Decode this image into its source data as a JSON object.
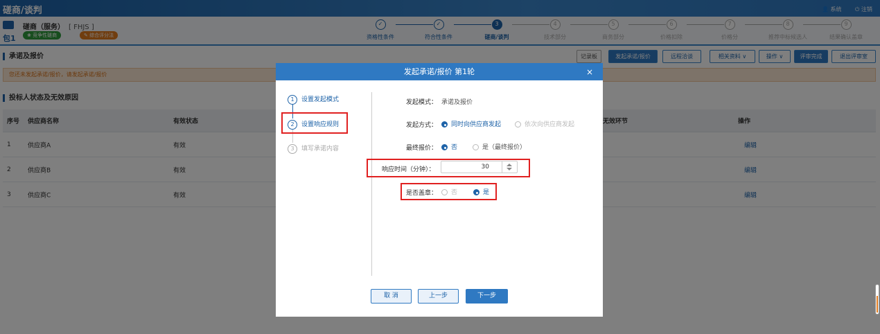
{
  "topbar": {
    "title": "磋商/谈判",
    "user": "👤 系统",
    "logout": "⏻ 注销"
  },
  "project": {
    "package": "包1",
    "name": "磋商（服务）",
    "code": "[ FHJS ]",
    "tag1": "竞争性磋商",
    "tag2": "综合评分法"
  },
  "steps": [
    {
      "num": "✓",
      "label": "资格性条件",
      "state": "done"
    },
    {
      "num": "✓",
      "label": "符合性条件",
      "state": "done"
    },
    {
      "num": "3",
      "label": "磋商/谈判",
      "state": "active"
    },
    {
      "num": "4",
      "label": "技术部分",
      "state": "todo"
    },
    {
      "num": "5",
      "label": "商务部分",
      "state": "todo"
    },
    {
      "num": "6",
      "label": "价格扣除",
      "state": "todo"
    },
    {
      "num": "7",
      "label": "价格分",
      "state": "todo"
    },
    {
      "num": "8",
      "label": "推荐中标候选人",
      "state": "todo"
    },
    {
      "num": "9",
      "label": "结果确认盖章",
      "state": "todo"
    }
  ],
  "section1": {
    "title": "承诺及报价"
  },
  "toolbar": {
    "record": "记录板",
    "initiate": "发起承诺/报价",
    "remote": "远程洽谈",
    "docs": "相关资料 ∨",
    "ops": "操作 ∨",
    "complete": "评审完成",
    "exit": "退出评审室"
  },
  "warning": "您还未发起承诺/报价，请发起承诺/报价",
  "section2": {
    "title": "投标人状态及无效原因"
  },
  "table": {
    "headers": {
      "no": "序号",
      "name": "供应商名称",
      "status": "有效状态",
      "step": "无效环节",
      "op": "操作"
    },
    "rows": [
      {
        "no": "1",
        "name": "供应商A",
        "status": "有效",
        "op": "编辑"
      },
      {
        "no": "2",
        "name": "供应商B",
        "status": "有效",
        "op": "编辑"
      },
      {
        "no": "3",
        "name": "供应商C",
        "status": "有效",
        "op": "编辑"
      }
    ]
  },
  "modal": {
    "title": "发起承诺/报价 第1轮",
    "close": "×",
    "nav": [
      {
        "num": "1",
        "label": "设置发起模式"
      },
      {
        "num": "2",
        "label": "设置响应规则"
      },
      {
        "num": "3",
        "label": "填写承诺内容"
      }
    ],
    "fields": {
      "mode_label": "发起模式：",
      "mode_value": "承诺及报价",
      "method_label": "发起方式：",
      "method_opt1": "同时向供应商发起",
      "method_opt2": "依次向供应商发起",
      "final_label": "最终报价：",
      "final_opt1": "否",
      "final_opt2": "是（最终报价）",
      "time_label": "响应时间（分钟）：",
      "time_value": "30",
      "seal_label": "是否盖章：",
      "seal_opt1": "否",
      "seal_opt2": "是"
    },
    "buttons": {
      "cancel": "取 消",
      "prev": "上一步",
      "next": "下一步"
    }
  }
}
